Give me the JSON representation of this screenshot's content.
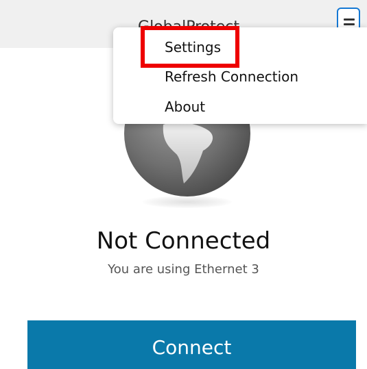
{
  "app": {
    "title": "GlobalProtect",
    "menu_icon": "hamburger-menu-icon"
  },
  "menu": {
    "items": [
      {
        "label": "Settings"
      },
      {
        "label": "Refresh Connection"
      },
      {
        "label": "About"
      }
    ]
  },
  "status": {
    "title": "Not Connected",
    "subtitle": "You are using Ethernet 3",
    "icon": "globe-icon"
  },
  "actions": {
    "connect_label": "Connect"
  },
  "colors": {
    "accent": "#0a79aa",
    "highlight": "#ee0000",
    "menu_button_border": "#1478d4"
  }
}
